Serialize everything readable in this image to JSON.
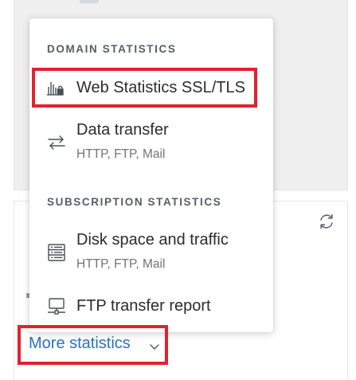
{
  "dropdown": {
    "domain_header": "DOMAIN STATISTICS",
    "subscription_header": "SUBSCRIPTION STATISTICS",
    "items": [
      {
        "label": "Web Statistics SSL/TLS",
        "icon": "web-statistics-lock-icon"
      },
      {
        "label": "Data transfer",
        "sub": "HTTP, FTP, Mail",
        "icon": "transfer-arrows-icon"
      },
      {
        "label": "Disk space and traffic",
        "sub": "HTTP, FTP, Mail",
        "icon": "disk-list-icon"
      },
      {
        "label": "FTP transfer report",
        "icon": "network-computer-icon"
      }
    ]
  },
  "more_statistics": {
    "label": "More statistics",
    "icon": "chevron-down-icon"
  },
  "colors": {
    "accent_link": "#2b70c4",
    "highlight": "#e1222f"
  }
}
